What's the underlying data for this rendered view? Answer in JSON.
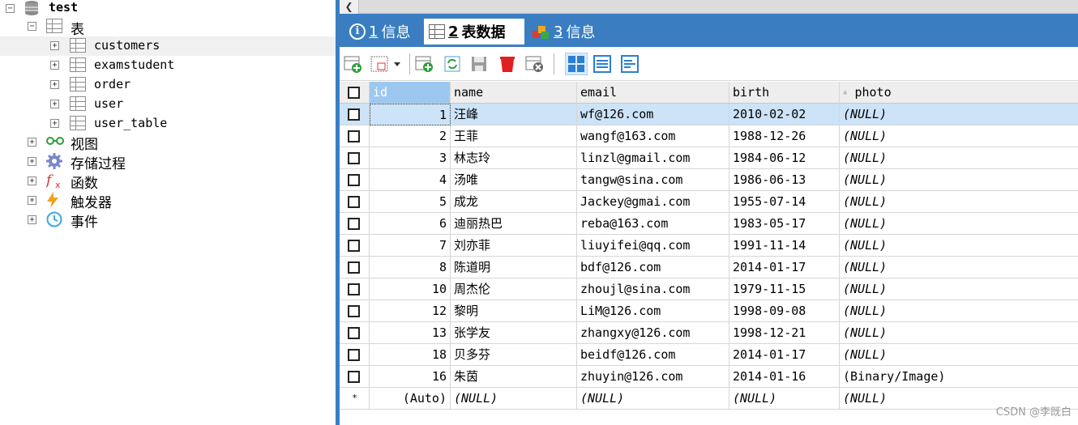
{
  "tree": {
    "database": "test",
    "tables_folder": "表",
    "tables": [
      "customers",
      "examstudent",
      "order",
      "user",
      "user_table"
    ],
    "selected_table": "customers",
    "folders": [
      {
        "label": "视图",
        "icon": "glasses-icon"
      },
      {
        "label": "存储过程",
        "icon": "gear-icon"
      },
      {
        "label": "函数",
        "icon": "function-icon"
      },
      {
        "label": "触发器",
        "icon": "lightning-icon"
      },
      {
        "label": "事件",
        "icon": "clock-icon"
      }
    ]
  },
  "tabs": [
    {
      "num": "1",
      "label": "信息",
      "active": false
    },
    {
      "num": "2",
      "label": "表数据",
      "active": true
    },
    {
      "num": "3",
      "label": "信息",
      "active": false
    }
  ],
  "grid": {
    "columns": [
      "id",
      "name",
      "email",
      "birth",
      "photo"
    ],
    "rows": [
      {
        "id": "1",
        "name": "汪峰",
        "email": "wf@126.com",
        "birth": "2010-02-02",
        "photo": "(NULL)"
      },
      {
        "id": "2",
        "name": "王菲",
        "email": "wangf@163.com",
        "birth": "1988-12-26",
        "photo": "(NULL)"
      },
      {
        "id": "3",
        "name": "林志玲",
        "email": "linzl@gmail.com",
        "birth": "1984-06-12",
        "photo": "(NULL)"
      },
      {
        "id": "4",
        "name": "汤唯",
        "email": "tangw@sina.com",
        "birth": "1986-06-13",
        "photo": "(NULL)"
      },
      {
        "id": "5",
        "name": "成龙",
        "email": "Jackey@gmai.com",
        "birth": "1955-07-14",
        "photo": "(NULL)"
      },
      {
        "id": "6",
        "name": "迪丽热巴",
        "email": "reba@163.com",
        "birth": "1983-05-17",
        "photo": "(NULL)"
      },
      {
        "id": "7",
        "name": "刘亦菲",
        "email": "liuyifei@qq.com",
        "birth": "1991-11-14",
        "photo": "(NULL)"
      },
      {
        "id": "8",
        "name": "陈道明",
        "email": "bdf@126.com",
        "birth": "2014-01-17",
        "photo": "(NULL)"
      },
      {
        "id": "10",
        "name": "周杰伦",
        "email": "zhoujl@sina.com",
        "birth": "1979-11-15",
        "photo": "(NULL)"
      },
      {
        "id": "12",
        "name": "黎明",
        "email": "LiM@126.com",
        "birth": "1998-09-08",
        "photo": "(NULL)"
      },
      {
        "id": "13",
        "name": "张学友",
        "email": "zhangxy@126.com",
        "birth": "1998-12-21",
        "photo": "(NULL)"
      },
      {
        "id": "18",
        "name": "贝多芬",
        "email": "beidf@126.com",
        "birth": "2014-01-17",
        "photo": "(NULL)"
      },
      {
        "id": "16",
        "name": "朱茵",
        "email": "zhuyin@126.com",
        "birth": "2014-01-16",
        "photo": "(Binary/Image)"
      }
    ],
    "new_row": {
      "marker": "*",
      "id": "(Auto)",
      "name": "(NULL)",
      "email": "(NULL)",
      "birth": "(NULL)",
      "photo": "(NULL)"
    },
    "selected_row": 0
  },
  "colors": {
    "accent": "#3a7ec1",
    "header_active": "#9cc8f0",
    "row_selected": "#cde3f7"
  },
  "watermark": "CSDN @李既白"
}
